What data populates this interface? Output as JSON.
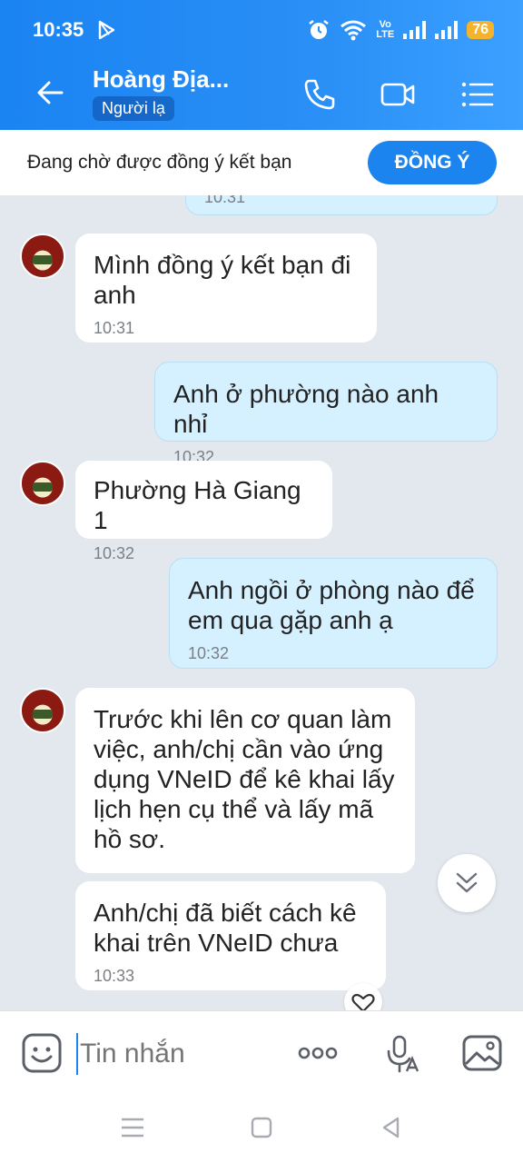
{
  "status_bar": {
    "time": "10:35",
    "volte_top": "Vo",
    "volte_bottom": "LTE",
    "battery": "76"
  },
  "header": {
    "contact_name": "Hoàng Địa...",
    "tag": "Người lạ",
    "icons": [
      "back-arrow-icon",
      "phone-icon",
      "video-call-icon",
      "menu-list-icon"
    ]
  },
  "friend_request": {
    "text": "Đang chờ được đồng ý kết bạn",
    "button": "ĐỒNG Ý"
  },
  "messages": [
    {
      "direction": "out",
      "text": "",
      "time": "10:31"
    },
    {
      "direction": "in",
      "text": "Mình đồng ý kết bạn đi anh",
      "time": "10:31"
    },
    {
      "direction": "out",
      "text": "Anh ở phường nào anh nhỉ",
      "time": "10:32"
    },
    {
      "direction": "in",
      "text": "Phường Hà Giang 1",
      "time": "10:32"
    },
    {
      "direction": "out",
      "text": "Anh ngồi ở phòng nào để em qua gặp anh ạ",
      "time": "10:32"
    },
    {
      "direction": "in",
      "text": "Trước khi lên cơ quan làm việc, anh/chị cần vào ứng dụng VNeID để kê khai lấy lịch hẹn cụ thể và lấy mã hồ sơ.",
      "time": ""
    },
    {
      "direction": "in",
      "text": "Anh/chị đã biết cách kê khai trên VNeID chưa",
      "time": "10:33"
    }
  ],
  "composer": {
    "placeholder": "Tin nhắn",
    "icons": [
      "emoji-sticker-icon",
      "more-options-icon",
      "voice-to-text-icon",
      "image-gallery-icon"
    ]
  },
  "colors": {
    "header_blue": "#1a84f2",
    "accept_button": "#1c84ee",
    "outgoing_bubble": "#d5f0ff",
    "chat_background": "#e3e8ef"
  }
}
